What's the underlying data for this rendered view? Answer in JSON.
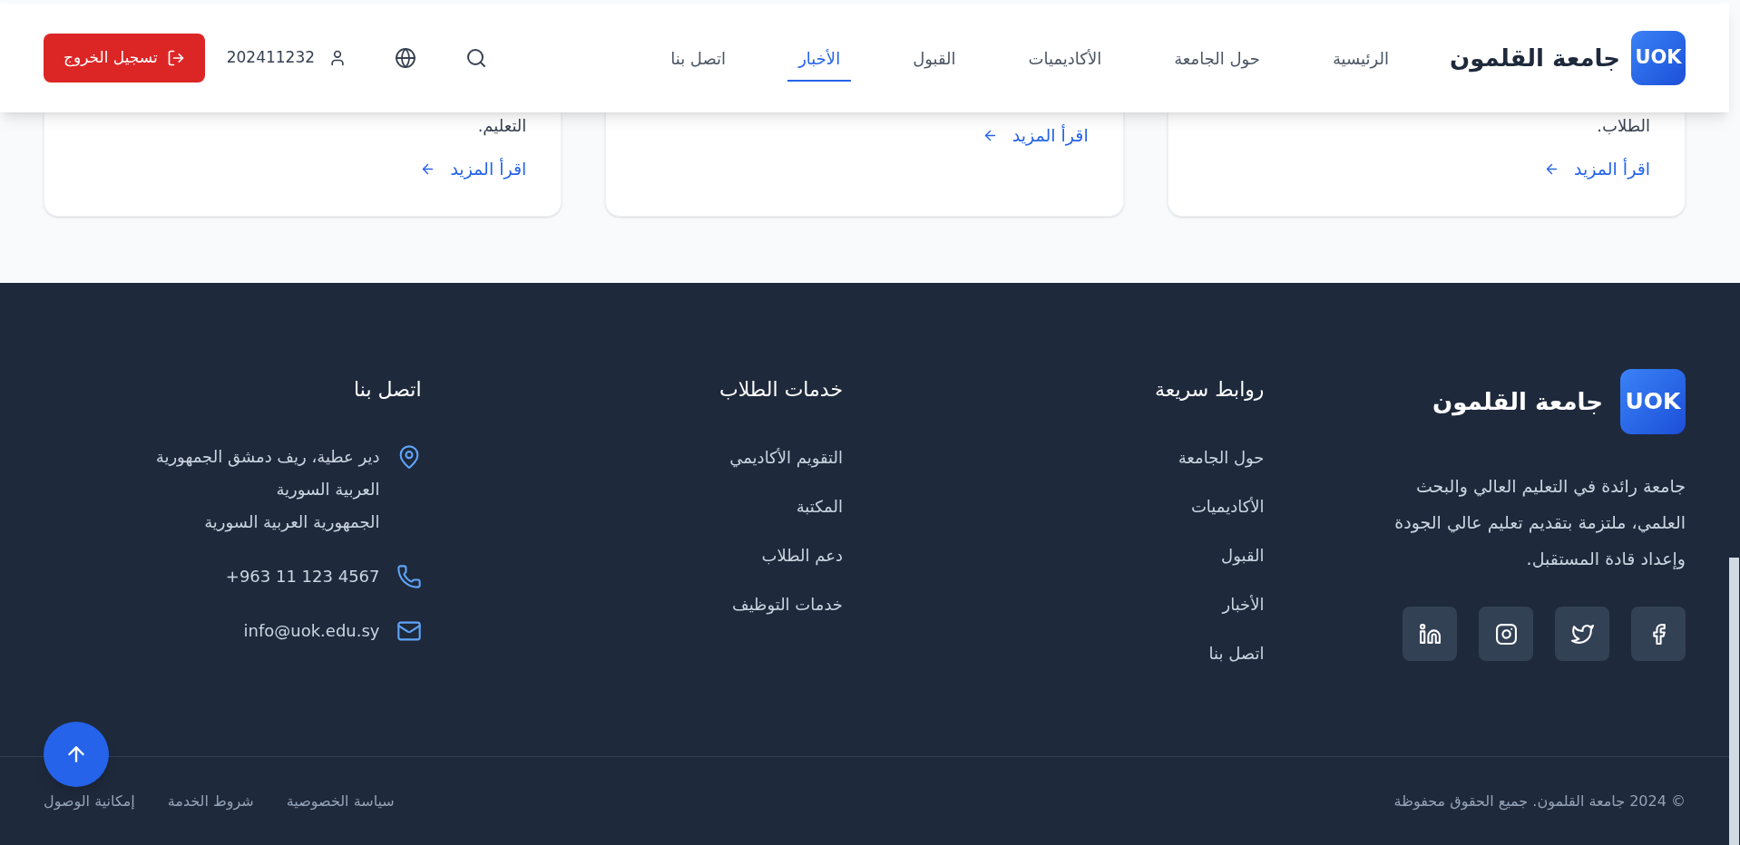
{
  "header": {
    "logo": {
      "mark": "UOK",
      "name": "جامعة القلمون"
    },
    "nav": [
      {
        "label": "الرئيسية",
        "selected": false
      },
      {
        "label": "حول الجامعة",
        "selected": false
      },
      {
        "label": "الأكاديميات",
        "selected": false
      },
      {
        "label": "القبول",
        "selected": false
      },
      {
        "label": "الأخبار",
        "selected": true
      },
      {
        "label": "اتصل بنا",
        "selected": false
      }
    ],
    "user_id": "202411232",
    "logout_button": "تسجيل الخروج"
  },
  "cards": [
    {
      "text": "الطلاب.",
      "link": "اقرأ المزيد"
    },
    {
      "link": "اقرأ المزيد"
    },
    {
      "text": "التعليم.",
      "link": "اقرأ المزيد"
    }
  ],
  "footer": {
    "brand": {
      "mark": "UOK",
      "name": "جامعة القلمون",
      "description": "جامعة رائدة في التعليم العالي والبحث العلمي، ملتزمة بتقديم تعليم عالي الجودة وإعداد قادة المستقبل."
    },
    "quick_links": {
      "title": "روابط سريعة",
      "links": [
        "حول الجامعة",
        "الأكاديميات",
        "القبول",
        "الأخبار",
        "اتصل بنا"
      ]
    },
    "student_services": {
      "title": "خدمات الطلاب",
      "links": [
        "التقويم الأكاديمي",
        "المكتبة",
        "دعم الطلاب",
        "خدمات التوظيف"
      ]
    },
    "contact": {
      "title": "اتصل بنا",
      "address_lines": [
        "دير عطية، ريف دمشق الجمهورية العربية السورية",
        "الجمهورية العربية السورية"
      ],
      "phone": "+963 11 123 4567",
      "email": "info@uok.edu.sy"
    },
    "bottom": {
      "copyright": "© 2024 جامعة القلمون. جميع الحقوق محفوظة",
      "links": [
        "سياسة الخصوصية",
        "شروط الخدمة",
        "إمكانية الوصول"
      ]
    }
  }
}
